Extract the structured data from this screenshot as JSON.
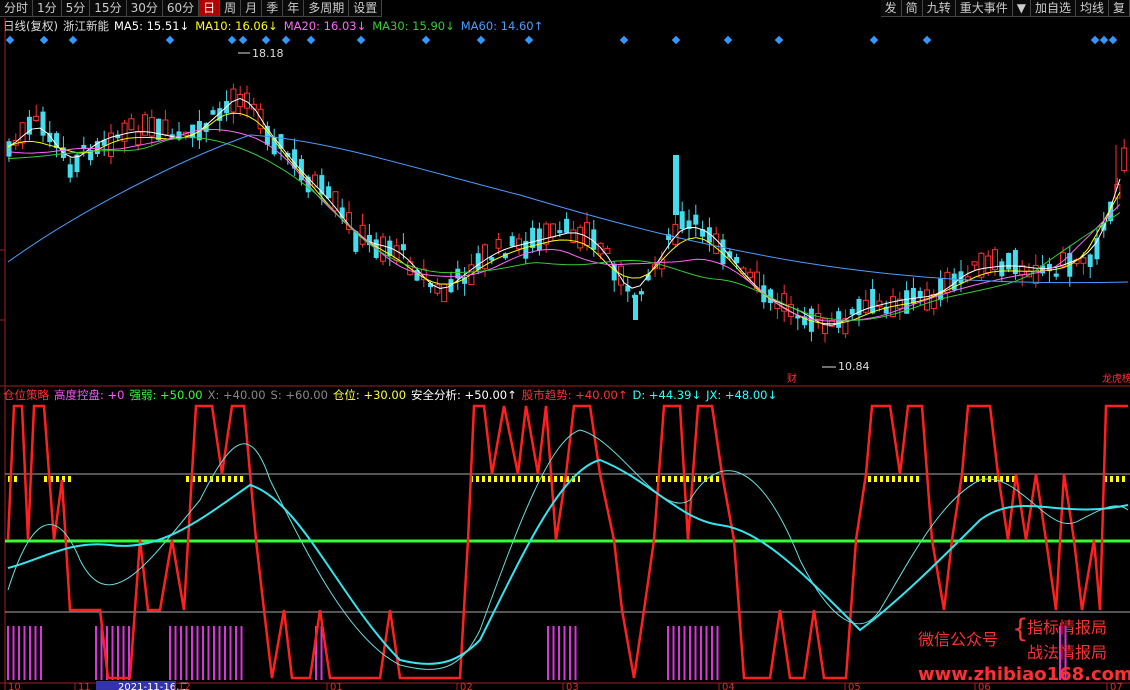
{
  "toolbar": {
    "left": [
      "分时",
      "1分",
      "5分",
      "15分",
      "30分",
      "60分",
      "日",
      "周",
      "月",
      "季",
      "年",
      "多周期",
      "设置"
    ],
    "active": "日",
    "right": [
      "发",
      "简",
      "九转",
      "重大事件",
      "▼",
      "加自选",
      "均线",
      "复"
    ]
  },
  "ma_row": {
    "period": "日线(复权)",
    "stock": "浙江新能",
    "items": [
      {
        "text": "MA5: 15.51↓",
        "color": "#ffffff"
      },
      {
        "text": "MA10: 16.06↓",
        "color": "#ffff00"
      },
      {
        "text": "MA20: 16.03↓",
        "color": "#ff66ff"
      },
      {
        "text": "MA30: 15.90↓",
        "color": "#33cc33"
      },
      {
        "text": "MA60: 14.60↑",
        "color": "#4a9cff"
      }
    ]
  },
  "price_labels": {
    "high": "18.18",
    "low": "10.84"
  },
  "event_markers": {
    "cai": "财",
    "bang": "龙虎榜"
  },
  "indicator_row": {
    "items": [
      {
        "text": "仓位策略",
        "color": "#ff3333"
      },
      {
        "text": "高度控盘: +0",
        "color": "#ff55ff"
      },
      {
        "text": "强弱: +50.00",
        "color": "#33ff33"
      },
      {
        "text": "X: +40.00",
        "color": "#888888"
      },
      {
        "text": "S: +60.00",
        "color": "#888888"
      },
      {
        "text": "仓位: +30.00",
        "color": "#ffff33"
      },
      {
        "text": "安全分析: +50.00↑",
        "color": "#ffffff"
      },
      {
        "text": "股市趋势: +40.00↑",
        "color": "#ff3333"
      },
      {
        "text": "D: +44.39↓",
        "color": "#33ffff"
      },
      {
        "text": "JX: +48.00↓",
        "color": "#33ffff"
      }
    ]
  },
  "date_axis": [
    "10",
    "11",
    "2021-11-16,二",
    "12",
    "01",
    "02",
    "03",
    "04",
    "05",
    "06",
    "07"
  ],
  "watermark": {
    "line1_left": "微信公众号",
    "line1_right": "指标情报局",
    "line2_right": "战法情报局",
    "url": "www.zhibiao168.com"
  },
  "colors": {
    "up": "#ff3030",
    "down": "#44ddee",
    "accent": "#b30000"
  }
}
